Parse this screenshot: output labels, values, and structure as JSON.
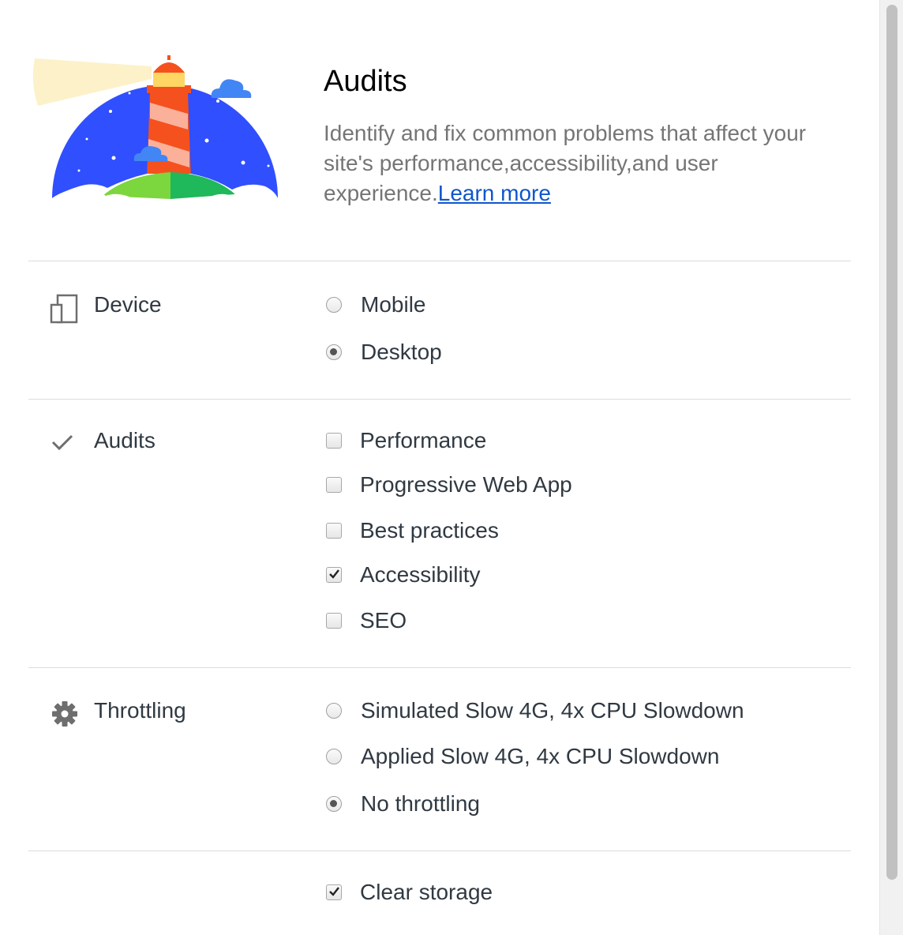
{
  "header": {
    "title": "Audits",
    "description": "Identify and fix common problems that affect your site's performance,accessibility,and user experience.",
    "learn_more": "Learn more"
  },
  "device": {
    "label": "Device",
    "options": [
      {
        "label": "Mobile",
        "checked": false
      },
      {
        "label": "Desktop",
        "checked": true
      }
    ]
  },
  "audits": {
    "label": "Audits",
    "options": [
      {
        "label": "Performance",
        "checked": false
      },
      {
        "label": "Progressive Web App",
        "checked": false
      },
      {
        "label": "Best practices",
        "checked": false
      },
      {
        "label": "Accessibility",
        "checked": true
      },
      {
        "label": "SEO",
        "checked": false
      }
    ]
  },
  "throttling": {
    "label": "Throttling",
    "options": [
      {
        "label": "Simulated Slow 4G, 4x CPU Slowdown",
        "checked": false
      },
      {
        "label": "Applied Slow 4G, 4x CPU Slowdown",
        "checked": false
      },
      {
        "label": "No throttling",
        "checked": true
      }
    ]
  },
  "storage": {
    "option": {
      "label": "Clear storage",
      "checked": true
    }
  },
  "icons": {
    "logo": "lighthouse-logo",
    "device": "device-icon",
    "audits": "checkmark-icon",
    "throttling": "gear-icon"
  },
  "colors": {
    "link": "#1155cc",
    "sky": "#304ffe",
    "lighthouse_red": "#f4511e",
    "grass": "#0f9d58"
  }
}
